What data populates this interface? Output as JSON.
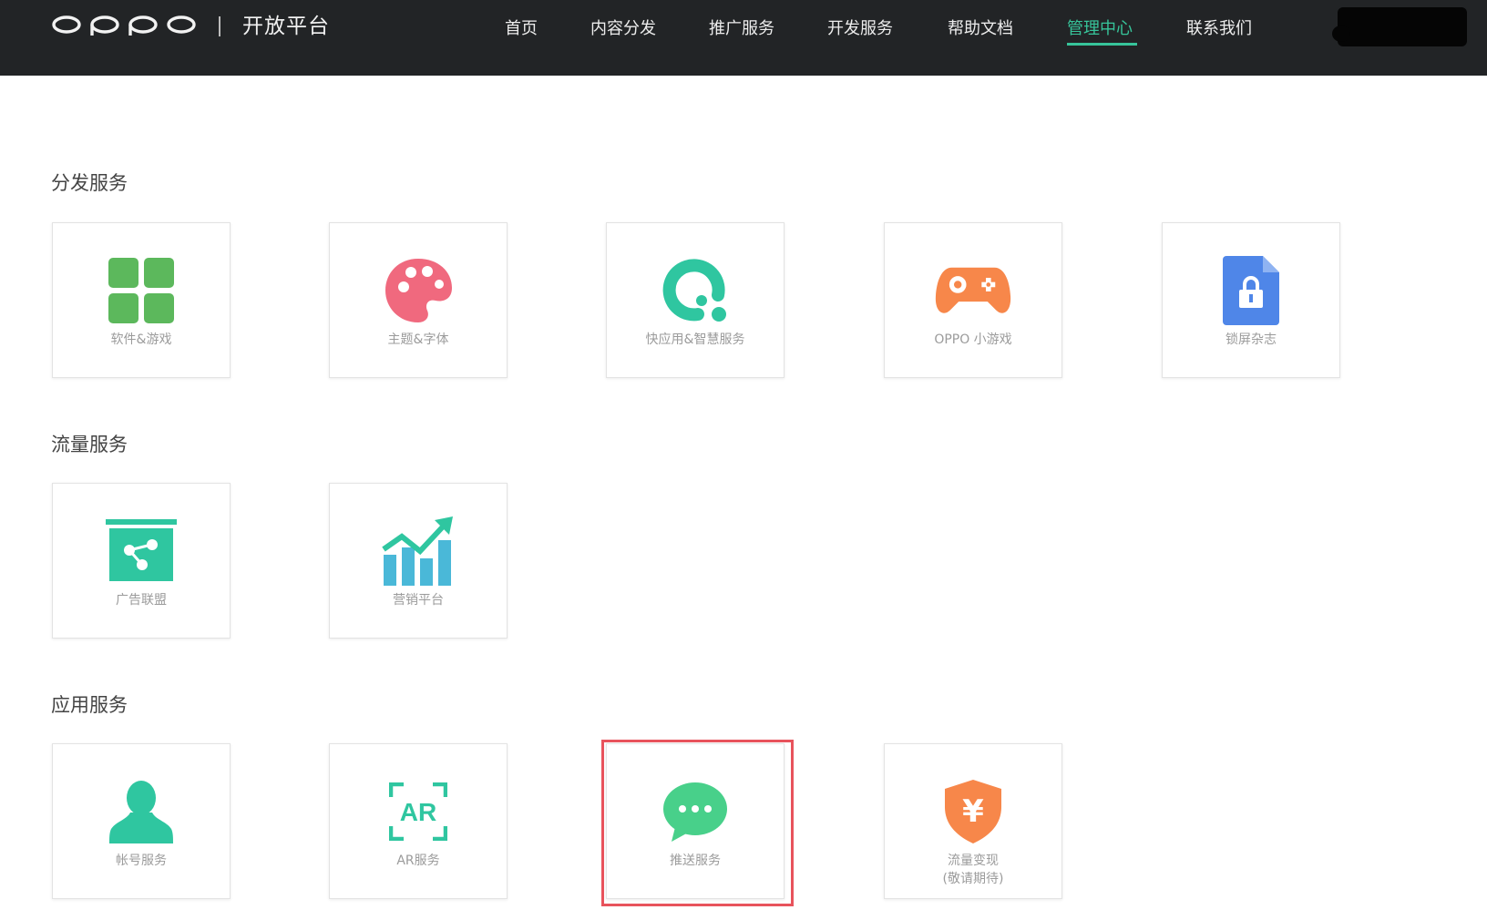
{
  "header": {
    "logo": "oppo",
    "platform": "开放平台",
    "nav": [
      "首页",
      "内容分发",
      "推广服务",
      "开发服务",
      "帮助文档",
      "管理中心",
      "联系我们"
    ],
    "active_nav": "管理中心",
    "accent": "#37c49a"
  },
  "sections": [
    {
      "title": "分发服务",
      "cards": [
        {
          "label": "软件&游戏",
          "icon": "app-grid-icon",
          "color": "#5cb85c"
        },
        {
          "label": "主题&字体",
          "icon": "palette-icon",
          "color": "#f0697e"
        },
        {
          "label": "快应用&智慧服务",
          "icon": "quick-app-icon",
          "color": "#2fc6a0"
        },
        {
          "label": "OPPO 小游戏",
          "icon": "gamepad-icon",
          "color": "#f7874a"
        },
        {
          "label": "锁屏杂志",
          "icon": "lock-file-icon",
          "color": "#4f86e8"
        }
      ]
    },
    {
      "title": "流量服务",
      "cards": [
        {
          "label": "广告联盟",
          "icon": "ad-board-icon",
          "color": "#2fc6a0"
        },
        {
          "label": "营销平台",
          "icon": "growth-chart-icon",
          "color": "#4ab8d8"
        }
      ]
    },
    {
      "title": "应用服务",
      "cards": [
        {
          "label": "帐号服务",
          "icon": "user-icon",
          "color": "#2fc6a0"
        },
        {
          "label": "AR服务",
          "icon": "ar-icon",
          "color": "#2fc6a0"
        },
        {
          "label": "推送服务",
          "icon": "chat-bubble-icon",
          "color": "#48d08a"
        },
        {
          "label": "流量变现\n(敬请期待)",
          "icon": "yuan-shield-icon",
          "color": "#f7874a"
        }
      ]
    }
  ],
  "highlighted_card": "推送服务",
  "highlight_color": "#e8535c"
}
